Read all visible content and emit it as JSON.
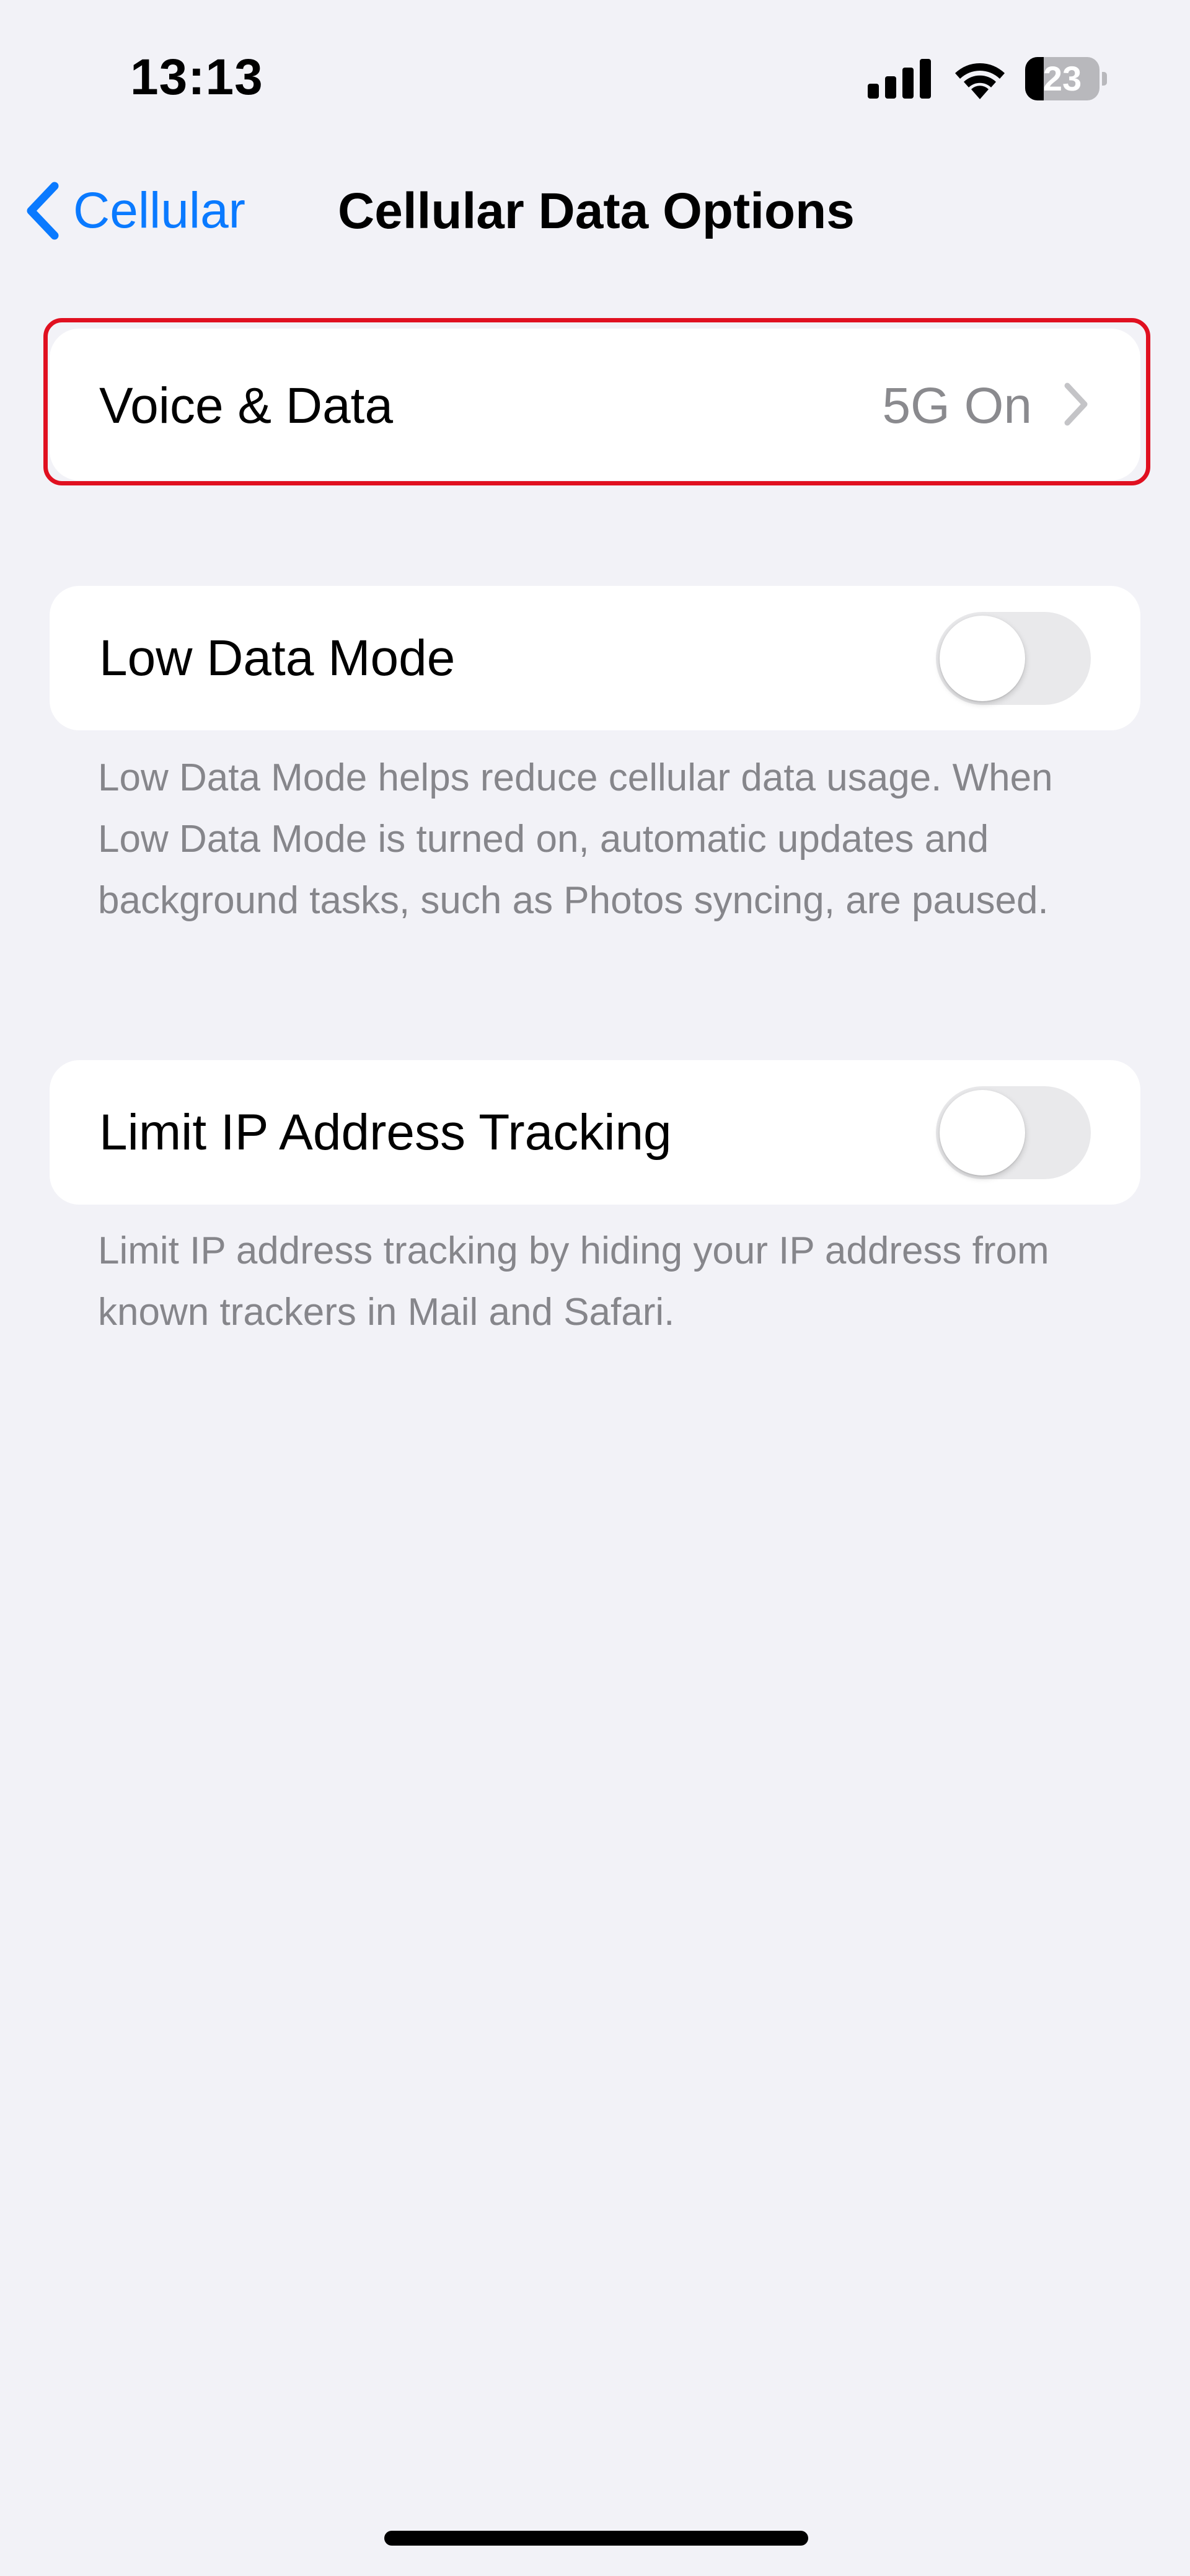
{
  "status_bar": {
    "time": "13:13",
    "battery_level": "23",
    "icons": [
      "signal-icon",
      "wifi-icon",
      "battery-icon"
    ]
  },
  "nav": {
    "back_label": "Cellular",
    "back_icon": "chevron-left-icon",
    "title": "Cellular Data Options"
  },
  "voice_data": {
    "label": "Voice & Data",
    "value": "5G On",
    "icon": "chevron-right-icon"
  },
  "low_data_mode": {
    "label": "Low Data Mode",
    "enabled": false,
    "footnote": "Low Data Mode helps reduce cellular data usage. When Low Data Mode is turned on, automatic updates and background tasks, such as Photos syncing, are paused."
  },
  "limit_ip": {
    "label": "Limit IP Address Tracking",
    "enabled": false,
    "footnote": "Limit IP address tracking by hiding your IP address from known trackers in Mail and Safari."
  },
  "colors": {
    "accent": "#0a7aff",
    "background": "#f2f2f7",
    "highlight": "#e01020",
    "secondary_text": "#86868b"
  }
}
